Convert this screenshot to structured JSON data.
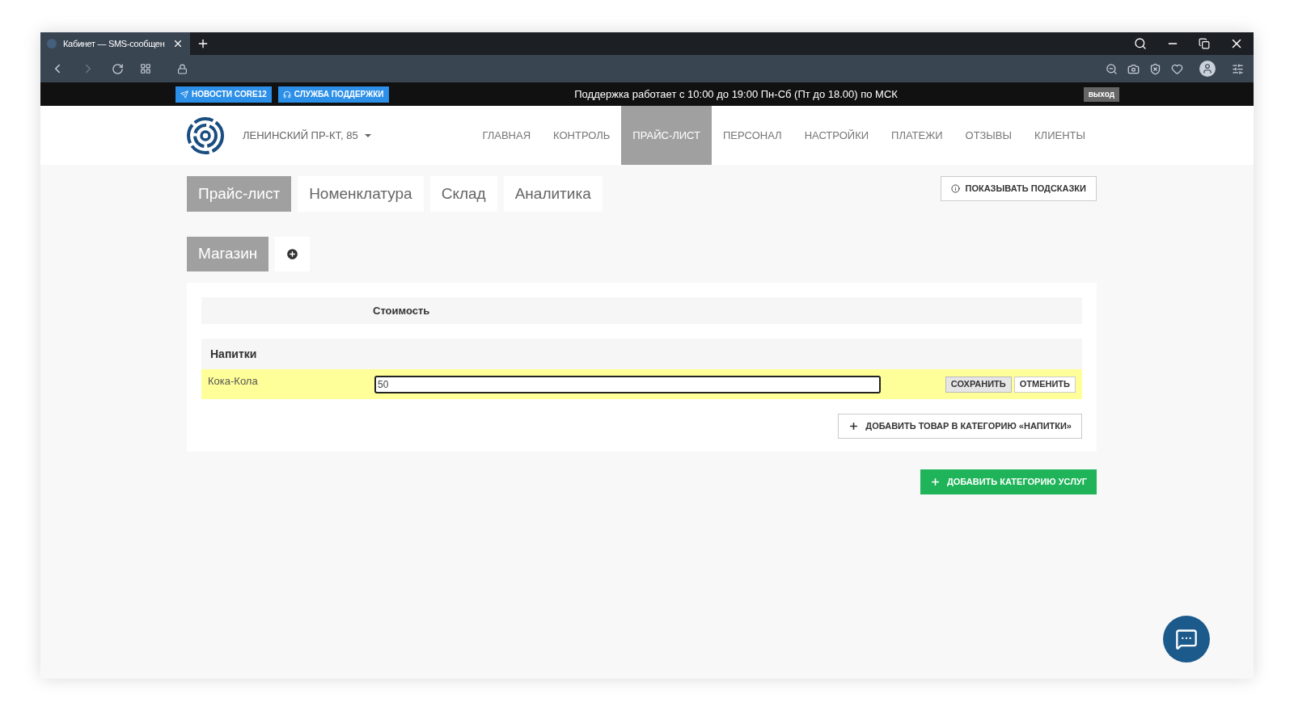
{
  "browser": {
    "tab_title": "Кабинет — SMS-сообщен"
  },
  "top_bar": {
    "links": [
      {
        "label": "НОВОСТИ CORE12",
        "kind": "telegram"
      },
      {
        "label": "СЛУЖБА ПОДДЕРЖКИ",
        "kind": "support"
      }
    ],
    "notice": "Поддержка работает с 10:00 до 19:00 Пн-Сб (Пт до 18.00) по МСК",
    "logout": "выход"
  },
  "header": {
    "location": "ЛЕНИНСКИЙ ПР-КТ, 85",
    "nav": [
      {
        "label": "ГЛАВНАЯ",
        "selected": false
      },
      {
        "label": "КОНТРОЛЬ",
        "selected": false
      },
      {
        "label": "ПРАЙС-ЛИСТ",
        "selected": true
      },
      {
        "label": "ПЕРСОНАЛ",
        "selected": false
      },
      {
        "label": "НАСТРОЙКИ",
        "selected": false
      },
      {
        "label": "ПЛАТЕЖИ",
        "selected": false
      },
      {
        "label": "ОТЗЫВЫ",
        "selected": false
      },
      {
        "label": "КЛИЕНТЫ",
        "selected": false
      }
    ]
  },
  "tabs": [
    {
      "label": "Прайс-лист",
      "selected": true
    },
    {
      "label": "Номенклатура",
      "selected": false
    },
    {
      "label": "Склад",
      "selected": false
    },
    {
      "label": "Аналитика",
      "selected": false
    }
  ],
  "hints_button": "ПОКАЗЫВАТЬ ПОДСКАЗКИ",
  "stores": [
    {
      "label": "Магазин",
      "selected": true
    }
  ],
  "table": {
    "columns": [
      "Стоимость"
    ],
    "categories": [
      {
        "name": "Напитки",
        "rows": [
          {
            "name": "Кока-Кола",
            "value": "50",
            "editing": true
          }
        ],
        "save": "СОХРАНИТЬ",
        "cancel": "ОТМЕНИТЬ",
        "add_item": "ДОБАВИТЬ ТОВАР В КАТЕГОРИЮ «НАПИТКИ»"
      }
    ]
  },
  "add_category": "ДОБАВИТЬ КАТЕГОРИЮ УСЛУГ"
}
